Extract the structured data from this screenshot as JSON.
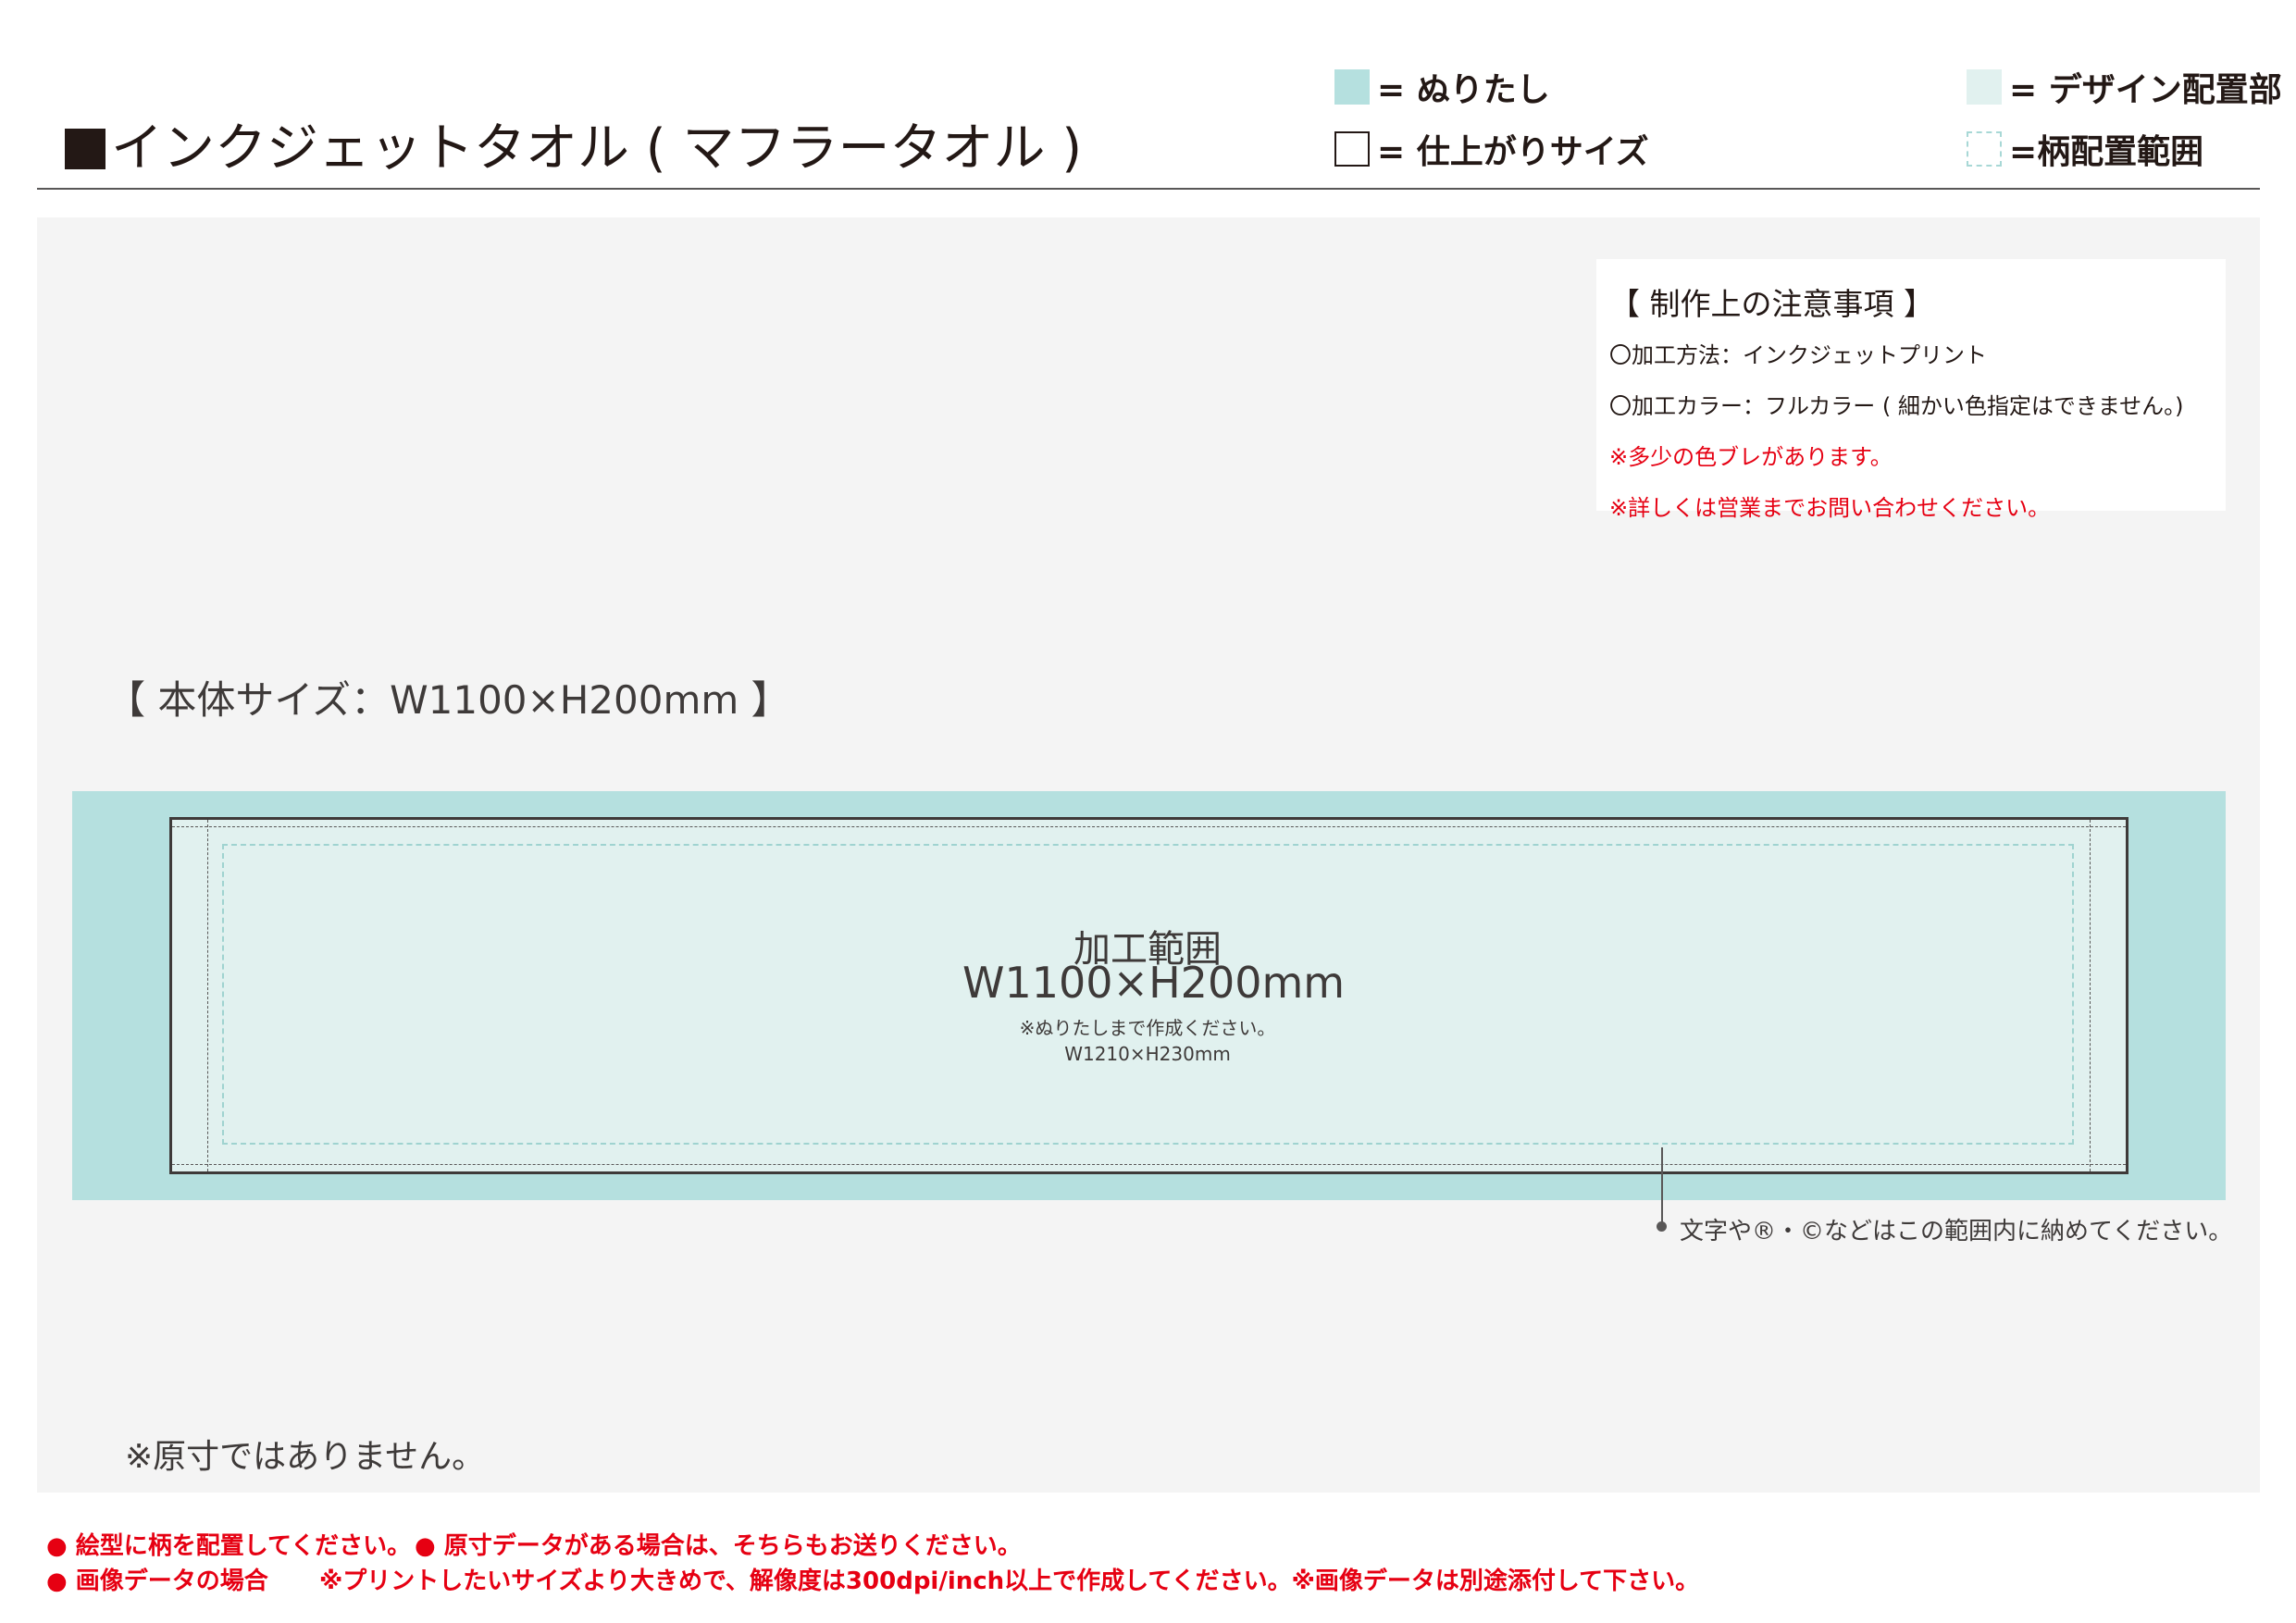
{
  "header": {
    "title": "インクジェットタオル ( マフラータオル )",
    "legend": {
      "bleed": "= ぬりたし",
      "finish": "= 仕上がりサイズ",
      "design": "= デザイン配置部",
      "pattern": "=柄配置範囲"
    }
  },
  "notes": {
    "title": "【 制作上の注意事項 】",
    "method": "〇加工方法：インクジェットプリント",
    "color": "〇加工カラー：フルカラー ( 細かい色指定はできません。)",
    "warning1": "※多少の色ブレがあります。",
    "warning2": "※詳しくは営業までお問い合わせください。"
  },
  "size_label": "【 本体サイズ：W1100×H200mm 】",
  "area": {
    "title": "加工範囲",
    "size": "W1100×H200mm",
    "note": "※ぬりたしまで作成ください。",
    "bleed_size": "W1210×H230mm"
  },
  "leader_text": "文字や®・©などはこの範囲内に納めてください。",
  "not_to_scale": "※原寸ではありません。",
  "footer": {
    "note1": "● 絵型に柄を配置してください。",
    "note2": "● 原寸データがある場合は、そちらもお送りください。",
    "note3": "● 画像データの場合",
    "note4": "※プリントしたいサイズより大きめで、解像度は300dpi/inch以上で作成してください。※画像データは別途添付して下さい。"
  },
  "colors": {
    "bleed": "#b5e0df",
    "design": "#e1f1ef",
    "warning": "#e60012",
    "canvas": "#f4f4f4"
  }
}
